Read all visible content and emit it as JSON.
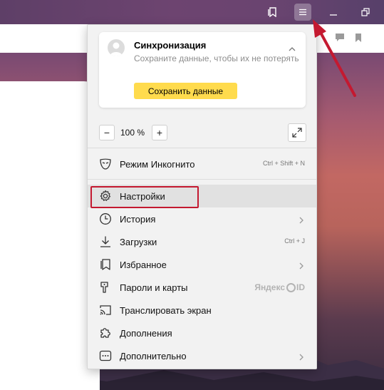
{
  "titlebar": {
    "icons": [
      "bookmarks-icon",
      "menu-icon",
      "minimize-icon",
      "restore-icon"
    ]
  },
  "sync": {
    "title": "Синхронизация",
    "subtitle": "Сохраните данные, чтобы их не потерять",
    "button": "Сохранить данные"
  },
  "zoom": {
    "minus": "−",
    "value": "100 %",
    "plus": "+"
  },
  "menu": {
    "incognito": {
      "label": "Режим Инкогнито",
      "shortcut": "Ctrl + Shift + N"
    },
    "settings": {
      "label": "Настройки"
    },
    "history": {
      "label": "История"
    },
    "downloads": {
      "label": "Загрузки",
      "shortcut": "Ctrl + J"
    },
    "favorites": {
      "label": "Избранное"
    },
    "passwords": {
      "label": "Пароли и карты",
      "badge_prefix": "Яндекс",
      "badge_suffix": "ID"
    },
    "cast": {
      "label": "Транслировать экран"
    },
    "extensions": {
      "label": "Дополнения"
    },
    "more": {
      "label": "Дополнительно"
    }
  },
  "colors": {
    "accent_yellow": "#ffdb4d",
    "highlight_red": "#c41930",
    "menu_bg": "#f2f2f2"
  }
}
